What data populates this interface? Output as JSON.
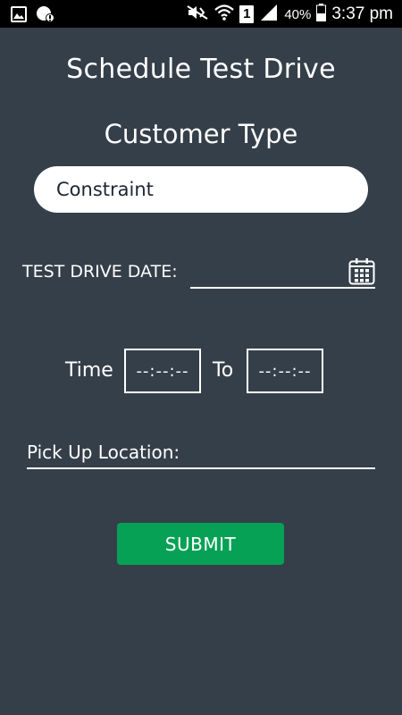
{
  "status_bar": {
    "battery_percent": "40%",
    "time": "3:37 pm",
    "sim_number": "1",
    "icons": [
      "gallery-icon",
      "whatsapp-icon",
      "mute-icon",
      "wifi-icon",
      "sim-icon",
      "signal-icon",
      "battery-icon"
    ]
  },
  "header": {
    "title": "Schedule Test Drive"
  },
  "customer": {
    "section_title": "Customer Type",
    "selected": "Constraint"
  },
  "date": {
    "label": "TEST DRIVE DATE:",
    "icon": "calendar-icon"
  },
  "time": {
    "label": "Time",
    "from_value": "--:--:--",
    "to_label": "To",
    "to_value": "--:--:--"
  },
  "pickup": {
    "label": "Pick Up Location:"
  },
  "actions": {
    "submit_label": "SUBMIT",
    "submit_color": "#06a155"
  },
  "theme": {
    "background": "#353f49"
  }
}
